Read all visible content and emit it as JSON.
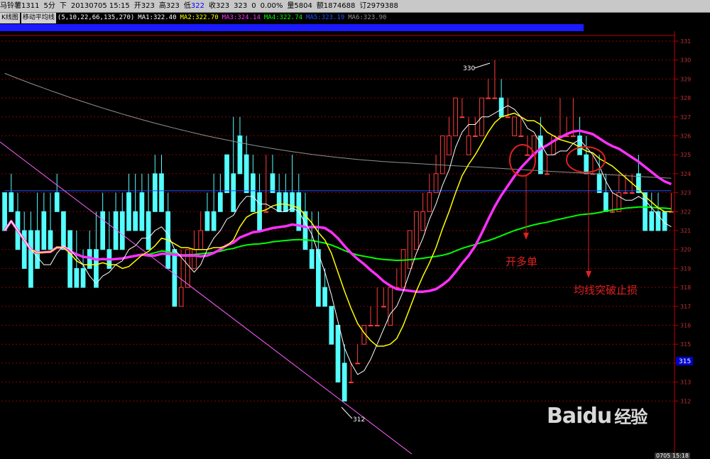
{
  "header": {
    "symbol": "马铃薯1311",
    "period": "5分",
    "dir": "下",
    "datetime": "20130705 15:15",
    "open": "开323",
    "high": "高323",
    "low_label": "低",
    "low_value": "322",
    "close": "收323",
    "last": "323",
    "change": "0",
    "pct": "0.00%",
    "volume": "量5804",
    "amount": "额1874688",
    "oi": "订2979388"
  },
  "indicator_bar": {
    "kline_btn": "K线图",
    "ma_btn": "移动平均线",
    "params": "(5,10,22,66,135,270)",
    "ma1": "MA1:322.40",
    "ma2": "MA2:322.70",
    "ma3": "MA3:324.14",
    "ma4": "MA4:322.74",
    "ma5": "MA5:323.19",
    "ma6": "MA6:323.90"
  },
  "annotations": {
    "open_long": "开多单",
    "stop_loss": "均线突破止损",
    "high_label": "330",
    "low_label": "312",
    "price_tag": "315"
  },
  "watermark": {
    "brand": "Baidu",
    "suffix": "经验"
  },
  "bottom_bar": {
    "left": "0705 15:18"
  },
  "colors": {
    "up": "#ff3c3c",
    "down": "#54ffff",
    "ma1": "#ffffff",
    "ma2": "#ffff00",
    "ma3": "#ff30ff",
    "ma4": "#00ff00",
    "ma5": "#2050ff",
    "ma6": "#909090",
    "grid": "#8b0000",
    "annot": "#e02020"
  },
  "chart_data": {
    "type": "candlestick",
    "ylim": [
      311,
      331
    ],
    "y_ticks": [
      312,
      313,
      314,
      315,
      316,
      317,
      318,
      319,
      320,
      321,
      322,
      323,
      324,
      325,
      326,
      327,
      328,
      329,
      330,
      331
    ],
    "candles": [
      [
        323,
        323,
        322,
        321
      ],
      [
        323,
        324,
        323,
        322
      ],
      [
        322,
        323,
        321,
        320
      ],
      [
        321,
        322,
        321,
        319
      ],
      [
        321,
        322,
        319,
        318
      ],
      [
        321,
        323,
        320,
        319
      ],
      [
        322,
        323,
        321,
        320
      ],
      [
        321,
        323,
        321,
        320
      ],
      [
        323,
        324,
        322,
        322
      ],
      [
        322,
        322,
        321,
        320
      ],
      [
        321,
        321,
        319,
        318
      ],
      [
        319,
        321,
        319,
        318
      ],
      [
        319,
        320,
        318,
        318
      ],
      [
        320,
        321,
        319,
        319
      ],
      [
        320,
        322,
        319,
        318
      ],
      [
        322,
        323,
        320,
        320
      ],
      [
        320,
        322,
        320,
        319
      ],
      [
        322,
        323,
        322,
        320
      ],
      [
        322,
        323,
        321,
        320
      ],
      [
        323,
        324,
        322,
        321
      ],
      [
        322,
        324,
        321,
        321
      ],
      [
        323,
        324,
        322,
        321
      ],
      [
        322,
        324,
        322,
        320
      ],
      [
        324,
        325,
        324,
        322
      ],
      [
        324,
        325,
        323,
        322
      ],
      [
        322,
        323,
        320,
        319
      ],
      [
        320,
        320,
        318,
        317
      ],
      [
        317,
        320,
        318,
        318
      ],
      [
        318,
        319,
        319,
        320
      ],
      [
        319,
        321,
        319,
        320
      ],
      [
        320,
        322,
        320,
        321
      ],
      [
        322,
        323,
        321,
        321
      ],
      [
        322,
        324,
        322,
        321
      ],
      [
        323,
        324,
        323,
        322
      ],
      [
        325,
        325,
        324,
        323
      ],
      [
        324,
        327,
        322,
        322
      ],
      [
        326,
        327,
        325,
        324
      ],
      [
        325,
        326,
        324,
        323
      ],
      [
        324,
        325,
        323,
        322
      ],
      [
        323,
        324,
        322,
        321
      ],
      [
        322,
        325,
        323,
        322
      ],
      [
        324,
        325,
        324,
        323
      ],
      [
        323,
        324,
        323,
        322
      ],
      [
        323,
        324,
        323,
        322
      ],
      [
        323,
        325,
        323,
        322
      ],
      [
        323,
        324,
        322,
        321
      ],
      [
        322,
        323,
        320,
        320
      ],
      [
        320,
        322,
        319,
        319
      ],
      [
        320,
        322,
        318,
        317
      ],
      [
        318,
        319,
        317,
        317
      ],
      [
        317,
        317,
        316,
        315
      ],
      [
        316,
        316,
        314,
        313
      ],
      [
        314,
        315,
        313,
        312
      ],
      [
        313,
        314,
        313,
        313
      ],
      [
        314,
        315,
        314,
        314
      ],
      [
        315,
        315,
        316,
        316
      ],
      [
        316,
        317,
        316,
        316
      ],
      [
        316,
        318,
        316,
        316
      ],
      [
        317,
        318,
        317,
        317
      ],
      [
        316,
        317,
        317,
        318
      ],
      [
        318,
        319,
        318,
        318
      ],
      [
        318,
        319,
        319,
        320
      ],
      [
        319,
        320,
        320,
        321
      ],
      [
        320,
        321,
        321,
        322
      ],
      [
        321,
        323,
        322,
        322
      ],
      [
        322,
        324,
        323,
        323
      ],
      [
        323,
        325,
        324,
        324
      ],
      [
        324,
        325,
        325,
        326
      ],
      [
        325,
        327,
        326,
        326
      ],
      [
        326,
        327,
        327,
        328
      ],
      [
        327,
        328,
        328,
        327
      ],
      [
        325,
        327,
        326,
        326
      ],
      [
        326,
        327,
        326,
        326
      ],
      [
        326,
        328,
        327,
        328
      ],
      [
        328,
        329,
        328,
        328
      ],
      [
        328,
        330,
        329,
        328
      ],
      [
        328,
        329,
        328,
        327
      ],
      [
        327,
        328,
        328,
        327
      ],
      [
        326,
        327,
        327,
        327
      ],
      [
        326,
        327,
        326,
        326
      ],
      [
        325,
        326,
        325,
        325
      ],
      [
        325,
        326,
        326,
        326
      ],
      [
        326,
        327,
        325,
        324
      ],
      [
        324,
        325,
        324,
        324
      ],
      [
        325,
        326,
        325,
        326
      ],
      [
        326,
        328,
        327,
        326
      ],
      [
        326,
        327,
        326,
        326
      ],
      [
        326,
        328,
        327,
        326
      ],
      [
        326,
        327,
        325,
        325
      ],
      [
        325,
        326,
        324,
        324
      ],
      [
        324,
        325,
        324,
        324
      ],
      [
        324,
        325,
        324,
        323
      ],
      [
        323,
        324,
        323,
        322
      ],
      [
        322,
        323,
        322,
        322
      ],
      [
        322,
        324,
        322,
        323
      ],
      [
        323,
        324,
        323,
        323
      ],
      [
        323,
        324,
        324,
        323
      ],
      [
        324,
        325,
        323,
        323
      ],
      [
        323,
        323,
        322,
        321
      ],
      [
        322,
        323,
        322,
        321
      ],
      [
        322,
        323,
        322,
        321
      ],
      [
        322,
        322,
        321,
        321
      ],
      [
        322,
        323,
        322,
        322
      ]
    ]
  }
}
